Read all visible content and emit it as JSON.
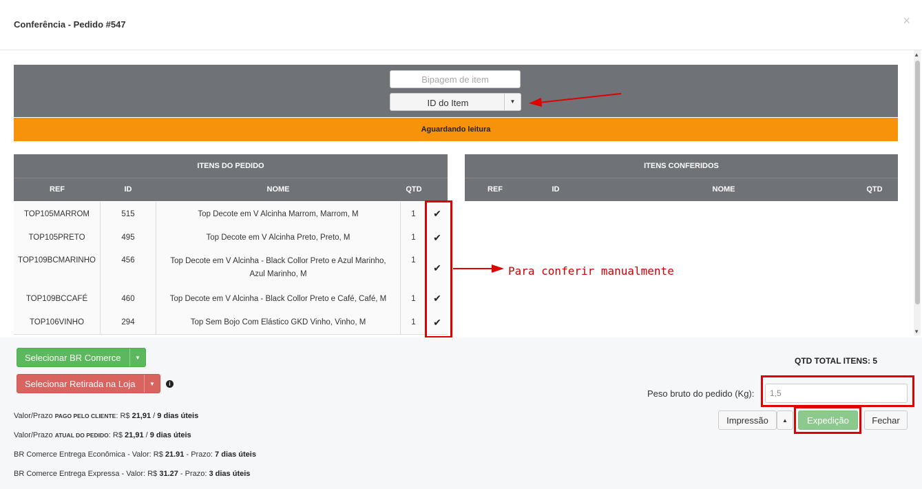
{
  "modal": {
    "title": "Conferência - Pedido #547",
    "close_icon": "×"
  },
  "scan": {
    "input_placeholder": "Bipagem de item",
    "mode_select": "ID do Item",
    "status": "Aguardando leitura",
    "status_color": "#f7930a"
  },
  "order_items": {
    "title": "ITENS DO PEDIDO",
    "columns": [
      "REF",
      "ID",
      "NOME",
      "QTD"
    ],
    "rows": [
      {
        "ref": "TOP105MARROM",
        "id": "515",
        "name": "Top Decote em V Alcinha Marrom, Marrom, M",
        "qty": "1",
        "check": "✔"
      },
      {
        "ref": "TOP105PRETO",
        "id": "495",
        "name": "Top Decote em V Alcinha Preto, Preto, M",
        "qty": "1",
        "check": "✔"
      },
      {
        "ref": "TOP109BCMARINHO",
        "id": "456",
        "name": "Top Decote em V Alcinha - Black Collor Preto e Azul Marinho, Azul Marinho, M",
        "qty": "1",
        "check": "✔"
      },
      {
        "ref": "TOP109BCCAFÉ",
        "id": "460",
        "name": "Top Decote em V Alcinha - Black Collor Preto e Café, Café, M",
        "qty": "1",
        "check": "✔"
      },
      {
        "ref": "TOP106VINHO",
        "id": "294",
        "name": "Top Sem Bojo Com Elástico GKD Vinho, Vinho, M",
        "qty": "1",
        "check": "✔"
      }
    ]
  },
  "checked_items": {
    "title": "ITENS CONFERIDOS",
    "columns": [
      "REF",
      "ID",
      "NOME",
      "QTD"
    ]
  },
  "annotation": {
    "note": "Para conferir manualmente",
    "color": "#e00000"
  },
  "footer": {
    "carrier_button": "Selecionar BR Comerce",
    "pickup_button": "Selecionar Retirada na Loja",
    "info_icon": "i",
    "shipping": {
      "line1_prefix": "Valor/Prazo ",
      "line1_tag": "PAGO PELO CLIENTE",
      "line1_sep": ": R$ ",
      "line1_value": "21,91",
      "line1_slash": " / ",
      "line1_days": "9 dias úteis",
      "line2_prefix": "Valor/Prazo ",
      "line2_tag": "ATUAL DO PEDIDO",
      "line2_sep": ": R$ ",
      "line2_value": "21,91",
      "line2_slash": " / ",
      "line2_days": "9 dias úteis",
      "line3_prefix": "BR Comerce Entrega Econômica - Valor: R$ ",
      "line3_value": "21.91",
      "line3_mid": " - Prazo: ",
      "line3_days": "7 dias úteis",
      "line4_prefix": "BR Comerce Entrega Expressa - Valor: R$ ",
      "line4_value": "31.27",
      "line4_mid": " - Prazo: ",
      "line4_days": "3 dias úteis"
    },
    "total_label": "QTD TOTAL ITENS: 5",
    "weight_label": "Peso bruto do pedido (Kg):",
    "weight_value": "1,5",
    "print_button": "Impressão",
    "dispatch_button": "Expedição",
    "close_button": "Fechar"
  }
}
